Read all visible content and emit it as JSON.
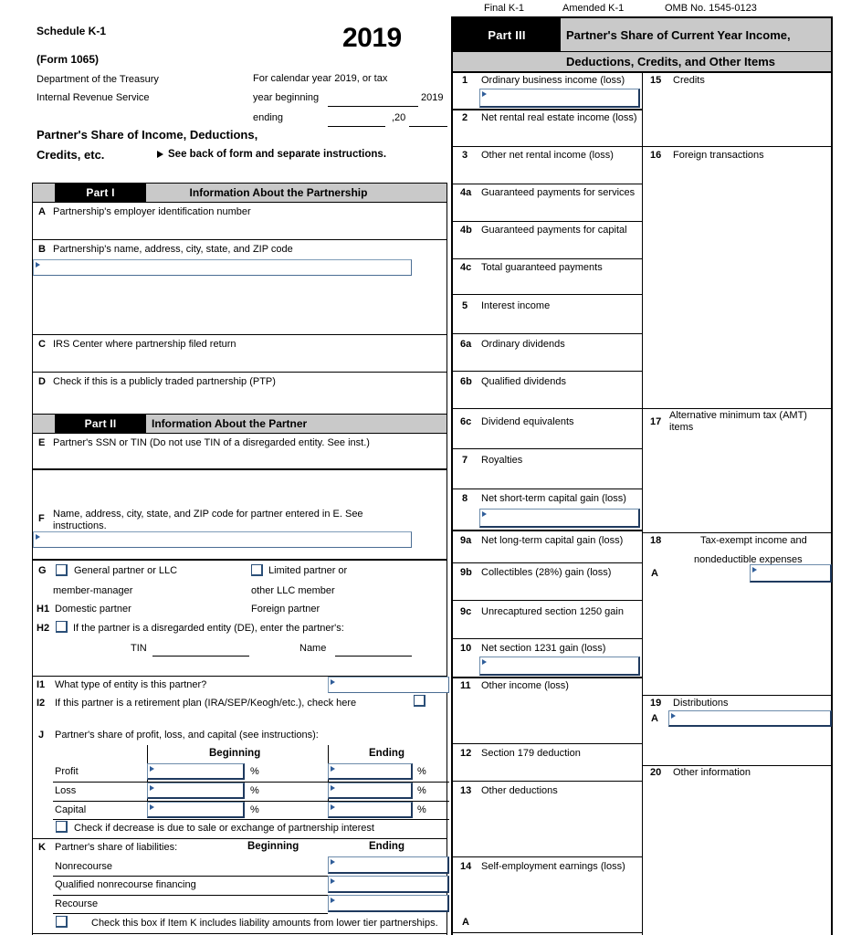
{
  "form": {
    "schedule_title": "Schedule K-1",
    "form_number": "(Form 1065)",
    "dept_line1": "Department of the Treasury",
    "dept_line2": "Internal Revenue Service",
    "year": "2019",
    "calendar_line": "For calendar year 2019, or tax",
    "year_beginning_label": "year beginning",
    "year_beginning_value": "2019",
    "ending_label": "ending",
    "ending_value": ",20",
    "main_title_line1": "Partner's Share of Income, Deductions,",
    "main_title_line2": "Credits, etc.",
    "see_back": "See back of form and separate instructions.",
    "final_k1": "Final K-1",
    "amended_k1": "Amended K-1",
    "omb": "OMB No. 1545-0123"
  },
  "part1": {
    "badge": "Part I",
    "heading": "Information About the Partnership",
    "rows": [
      {
        "letter": "A",
        "label": "Partnership's employer identification number"
      },
      {
        "letter": "B",
        "label": "Partnership's name, address, city, state, and ZIP code"
      },
      {
        "letter": "C",
        "label": "IRS Center where partnership filed return"
      },
      {
        "letter": "D",
        "label": "Check if this is a publicly traded partnership (PTP)"
      }
    ]
  },
  "part2": {
    "badge": "Part II",
    "heading": "Information About the Partner",
    "row_e": {
      "letter": "E",
      "label": "Partner's SSN or TIN (Do not use TIN of a disregarded entity. See inst.)"
    },
    "row_f": {
      "letter": "F",
      "label_line1": "Name, address, city, state, and ZIP code for partner entered in E. See",
      "label_line2": "instructions."
    },
    "row_g": {
      "letter": "G",
      "left_line1": "General partner or LLC",
      "left_line2": "member-manager",
      "right_line1": "Limited partner or",
      "right_line2": "other LLC member"
    },
    "row_h1": {
      "letter": "H1",
      "left": "Domestic partner",
      "right": "Foreign partner"
    },
    "row_h2": {
      "letter": "H2",
      "label": "If the partner is a disregarded entity (DE), enter the partner's:",
      "tin_label": "TIN",
      "name_label": "Name"
    },
    "row_i1": {
      "letter": "I1",
      "label": "What type of entity is this partner?"
    },
    "row_i2": {
      "letter": "I2",
      "label": "If this partner is a retirement plan (IRA/SEP/Keogh/etc.), check here"
    },
    "row_j": {
      "letter": "J",
      "label": "Partner's share of profit, loss, and capital (see instructions):",
      "col_beginning": "Beginning",
      "col_ending": "Ending",
      "rows": [
        "Profit",
        "Loss",
        "Capital"
      ],
      "percent": "%",
      "checkbox_label": "Check if decrease is due to sale or exchange of partnership interest"
    },
    "row_k": {
      "letter": "K",
      "label": "Partner's share of liabilities:",
      "col_beginning": "Beginning",
      "col_ending": "Ending",
      "rows": [
        "Nonrecourse",
        "Qualified nonrecourse financing",
        "Recourse"
      ],
      "checkbox_label": "Check this box if Item K includes liability amounts from lower tier partnerships."
    }
  },
  "part3": {
    "badge": "Part III",
    "heading_line1": "Partner's Share of Current Year Income,",
    "heading_line2": "Deductions, Credits, and Other Items",
    "middle_items": [
      {
        "num": "1",
        "label": "Ordinary business income (loss)"
      },
      {
        "num": "2",
        "label": "Net rental real estate income (loss)"
      },
      {
        "num": "3",
        "label": "Other net rental income (loss)"
      },
      {
        "num": "4a",
        "label": "Guaranteed payments for services"
      },
      {
        "num": "4b",
        "label": "Guaranteed payments for capital"
      },
      {
        "num": "4c",
        "label": "Total guaranteed payments"
      },
      {
        "num": "5",
        "label": "Interest income"
      },
      {
        "num": "6a",
        "label": "Ordinary dividends"
      },
      {
        "num": "6b",
        "label": "Qualified dividends"
      },
      {
        "num": "6c",
        "label": "Dividend equivalents"
      },
      {
        "num": "7",
        "label": "Royalties"
      },
      {
        "num": "8",
        "label": "Net short-term capital gain (loss)"
      },
      {
        "num": "9a",
        "label": "Net long-term capital gain (loss)"
      },
      {
        "num": "9b",
        "label": "Collectibles (28%) gain (loss)"
      },
      {
        "num": "9c",
        "label": "Unrecaptured section 1250 gain"
      },
      {
        "num": "10",
        "label": "Net section 1231 gain (loss)"
      },
      {
        "num": "11",
        "label": "Other income (loss)"
      },
      {
        "num": "12",
        "label": "Section 179 deduction"
      },
      {
        "num": "13",
        "label": "Other deductions"
      },
      {
        "num": "14",
        "label": "Self-employment earnings (loss)"
      },
      {
        "num": "A",
        "label": ""
      }
    ],
    "right_items": [
      {
        "num": "15",
        "label": "Credits"
      },
      {
        "num": "16",
        "label": "Foreign transactions"
      },
      {
        "num": "17",
        "label": "Alternative minimum tax (AMT) items"
      },
      {
        "num": "18",
        "label_line1": "Tax-exempt income and",
        "label_line2": "nondeductible expenses",
        "sub": "A"
      },
      {
        "num": "19",
        "label": "Distributions",
        "sub": "A"
      },
      {
        "num": "20",
        "label": "Other information"
      }
    ]
  },
  "colors": {
    "band_gray": "#c9c9c9",
    "band_black": "#000000",
    "field_border": "#1f3a5f",
    "field_border_light": "#6d8cab"
  }
}
